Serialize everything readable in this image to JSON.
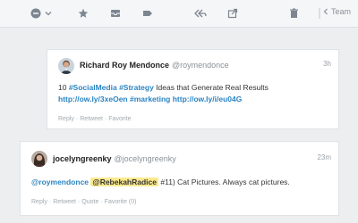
{
  "toolbar": {
    "team_label": "Team",
    "icons": [
      "status-icon",
      "chevron-down-icon",
      "star-icon",
      "inbox-icon",
      "tag-icon",
      "reply-all-icon",
      "share-icon",
      "trash-icon",
      "more-icon",
      "chevron-left-icon"
    ]
  },
  "tweets": [
    {
      "name": "Richard Roy Mendonce",
      "handle": "@roymendonce",
      "time": "3h",
      "line1_prefix": "10 ",
      "tags1": [
        "#SocialMedia",
        "#Strategy"
      ],
      "line1_suffix": " Ideas that Generate Real Results",
      "line2": [
        "http://ow.ly/3xeOen",
        "#marketing",
        "http://ow.ly/i/eu04G"
      ],
      "actions": [
        "Reply",
        "Retweet",
        "Favorite"
      ]
    },
    {
      "name": "jocelyngreenky",
      "handle": "@jocelyngreenky",
      "time": "23m",
      "mention1": "@roymendonce",
      "mention2": "@RebekahRadice",
      "text": " #11) Cat Pictures. Always cat pictures.",
      "actions": [
        "Reply",
        "Retweet",
        "Quote",
        "Favorite (0)"
      ]
    }
  ],
  "colors": {
    "link": "#2b84c2",
    "highlight": "#fbe98f",
    "background": "#eceef0"
  }
}
